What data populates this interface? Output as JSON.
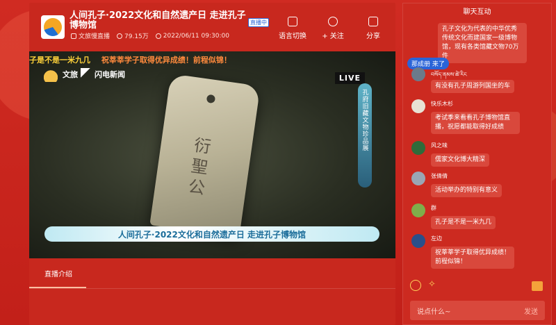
{
  "header": {
    "title": "人间孔子·2022文化和自然遗产日 走进孔子博物馆",
    "live_tag": "直播中",
    "channel": "文旅慢直播",
    "viewers": "79.15万",
    "datetime": "2022/06/11 09:30:00",
    "actions": [
      {
        "label": "语言切换",
        "icon": "translate-icon"
      },
      {
        "label": "+ 关注",
        "icon": "heart-plus-icon"
      },
      {
        "label": "分享",
        "icon": "share-icon"
      }
    ]
  },
  "video": {
    "ticker_1": "子是不是一米九几",
    "ticker_2": "祝莘莘学子取得优异成绩！前程似锦！",
    "brand": "文旅",
    "brand2": "闪电新闻",
    "live_badge": "LIVE",
    "side_banner": "孔府旧藏文物珍品展",
    "artifact_text": "衍聖公",
    "caption": "人间孔子·2022文化和自然遗产日 走进孔子博物馆"
  },
  "tabs": {
    "intro": "直播介绍"
  },
  "chat": {
    "title": "聊天互动",
    "system_pill": "那成册 来了",
    "messages": [
      {
        "name": "",
        "text": "孔子文化为代表的中华优秀传统文化而建国家一级博物馆，现有各类馆藏文物70万件"
      },
      {
        "name": "བསོད་ནམས་ཚེ་རིང",
        "text": "有没有孔子周游列国坐的车"
      },
      {
        "name": "快乐木杉",
        "text": "考试季来看看孔子博物馆直播，祝愿都能取得好成绩"
      },
      {
        "name": "风之味",
        "text": "儒家文化博大精深"
      },
      {
        "name": "张倩倩",
        "text": "活动举办的特别有意义"
      },
      {
        "name": "群",
        "text": "孔子是不是一米九几"
      },
      {
        "name": "左边",
        "text": "祝莘莘学子取得优异成绩！前程似锦！"
      }
    ],
    "input_placeholder": "说点什么~",
    "send_label": "发送"
  },
  "colors": {
    "page_bg": "#c9261d",
    "accent_blue": "#2a64d8",
    "ticker_yellow": "#ffd23a"
  }
}
